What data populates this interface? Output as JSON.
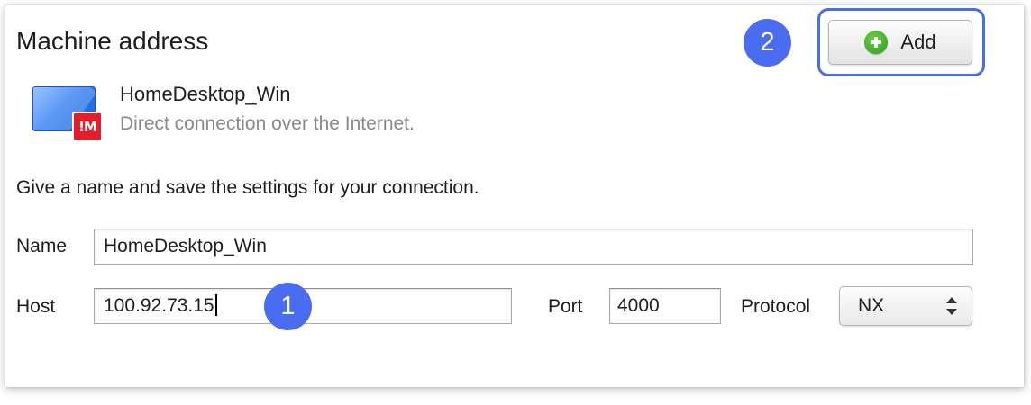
{
  "header": {
    "title": "Machine address",
    "add_button_label": "Add"
  },
  "annotations": {
    "badge_1": "1",
    "badge_2": "2",
    "highlight_color": "#4a6cf0"
  },
  "connection": {
    "name": "HomeDesktop_Win",
    "description": "Direct connection over the Internet.",
    "icon": "monitor-icon",
    "logo_text": "!M",
    "logo_color": "#e31d2a"
  },
  "form": {
    "instructions": "Give a name and save the settings for your connection.",
    "name_label": "Name",
    "name_value": "HomeDesktop_Win",
    "host_label": "Host",
    "host_value": "100.92.73.15",
    "port_label": "Port",
    "port_value": "4000",
    "protocol_label": "Protocol",
    "protocol_value": "NX"
  }
}
